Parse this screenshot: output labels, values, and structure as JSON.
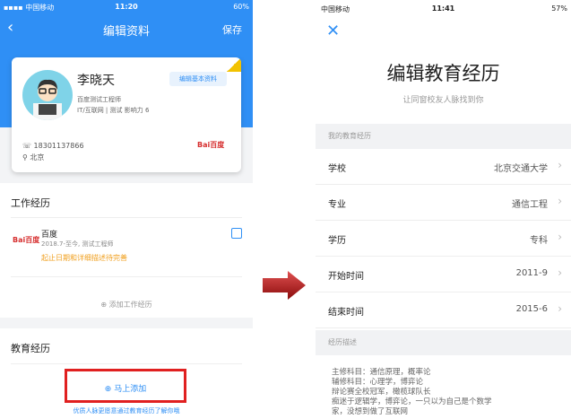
{
  "left": {
    "status": {
      "carrier": "▪▪▪▪ 中国移动",
      "time": "11:20",
      "right": "60%"
    },
    "nav": {
      "back_glyph": "‹",
      "title": "编辑资料",
      "save": "保存"
    },
    "profile": {
      "name": "李晓天",
      "edit_button": "编辑基本资料",
      "job": "百度测试工程师",
      "industry": "IT/互联网 | 测试 影响力 6",
      "phone": "18301137866",
      "city": "北京",
      "company_logo": "Bai百度"
    },
    "work": {
      "title": "工作经历",
      "company": "百度",
      "period": "2018.7-至今, 测试工程师",
      "warning": "起止日期和详细描述待完善",
      "add": "添加工作经历"
    },
    "education": {
      "title": "教育经历",
      "add_now": "马上添加",
      "hint": "优质人脉更愿意通过教育经历了解你哦"
    }
  },
  "right": {
    "status": {
      "carrier": "中国移动",
      "time": "11:41",
      "right": "57%"
    },
    "close_glyph": "✕",
    "title": "编辑教育经历",
    "subtitle": "让同窗校友人脉找到你",
    "section1": "我的教育经历",
    "rows": [
      {
        "label": "学校",
        "value": "北京交通大学"
      },
      {
        "label": "专业",
        "value": "通信工程"
      },
      {
        "label": "学历",
        "value": "专科"
      },
      {
        "label": "开始时间",
        "value": "2011-9"
      },
      {
        "label": "结束时间",
        "value": "2015-6"
      }
    ],
    "section2": "经历描述",
    "description": [
      "主修科目：通信原理，概率论",
      "辅修科目：心理学，博弈论",
      "辩论赛全校冠军，橄榄球队长",
      "痴迷于逻辑学，博弈论，一只以为自己是个数学",
      "家，没想到做了互联网"
    ]
  },
  "colors": {
    "accent": "#2f8ff5",
    "highlight": "#e02020",
    "warning": "#f0a020"
  }
}
